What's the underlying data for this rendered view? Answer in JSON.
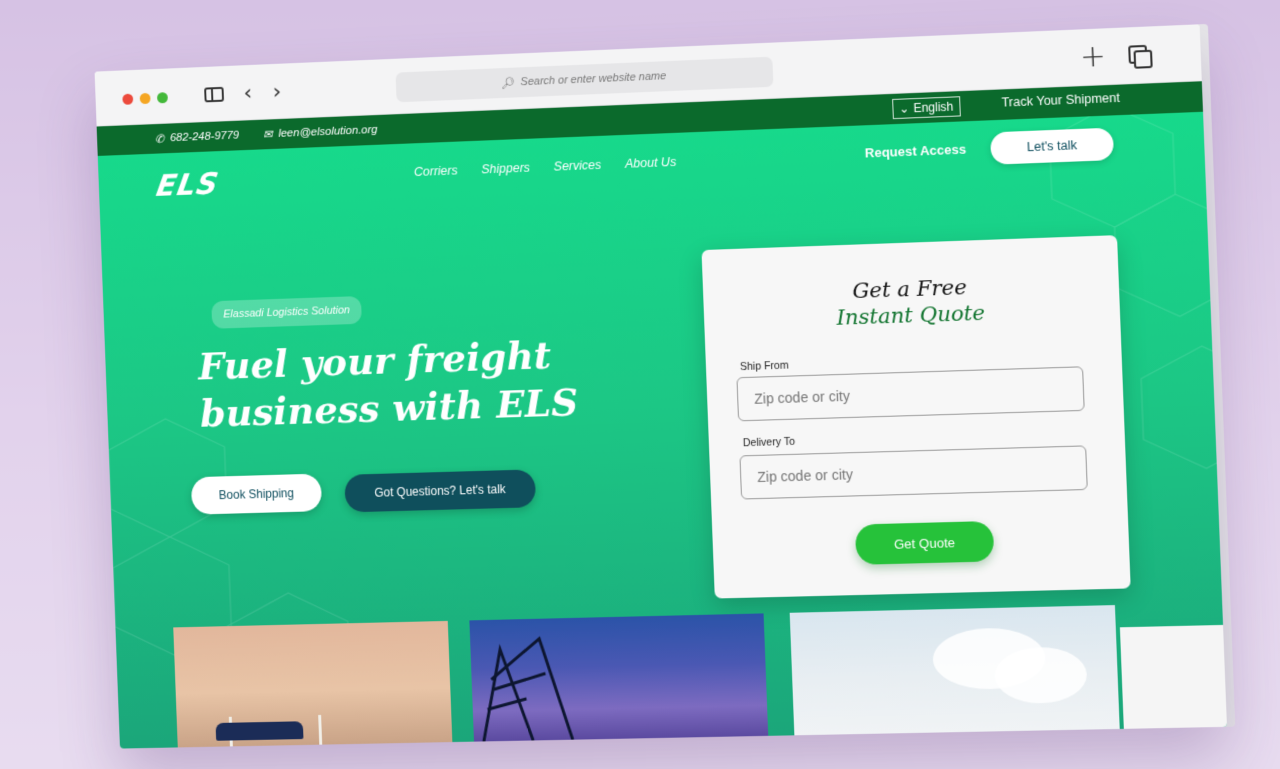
{
  "browser": {
    "search_placeholder": "Search or enter website name",
    "new_tab_symbol": "+",
    "back_symbol": "‹",
    "forward_symbol": "›"
  },
  "topbar": {
    "phone": "682-248-9779",
    "email": "leen@elsolution.org",
    "language": "English",
    "track": "Track Your Shipment"
  },
  "header": {
    "logo": "ELS",
    "nav": [
      "Corriers",
      "Shippers",
      "Services",
      "About Us"
    ],
    "request_access": "Request Access",
    "lets_talk": "Let's talk"
  },
  "hero": {
    "badge": "Elassadi Logistics Solution",
    "headline_line1": "Fuel your freight",
    "headline_line2": "business with ELS",
    "book_button": "Book Shipping",
    "questions_button": "Got Questions? Let's talk"
  },
  "quote": {
    "title_line1": "Get a Free",
    "title_line2": "Instant Quote",
    "from_label": "Ship From",
    "from_placeholder": "Zip code or city",
    "to_label": "Delivery To",
    "to_placeholder": "Zip code or city",
    "submit": "Get Quote"
  },
  "colors": {
    "brand_green": "#17d98b",
    "dark_green": "#0b6a2c",
    "quote_green": "#11742f",
    "button_green": "#26c23a",
    "teal_button": "#0f4f5c"
  }
}
